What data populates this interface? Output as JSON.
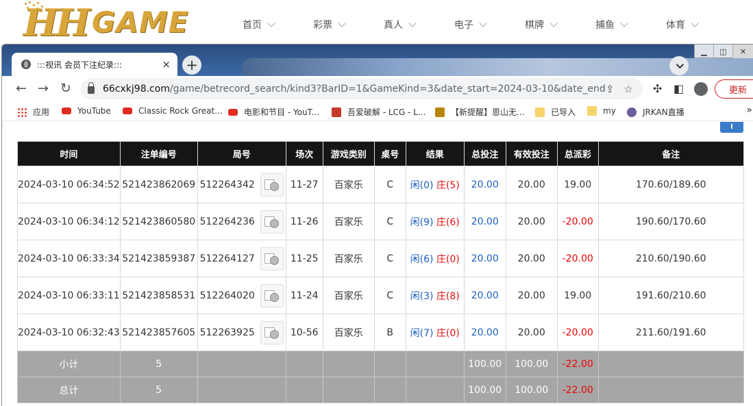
{
  "site": {
    "logo_hh": "HH",
    "logo_game": "GAME",
    "nav": [
      "首页",
      "彩票",
      "真人",
      "电子",
      "棋牌",
      "捕鱼",
      "体育"
    ]
  },
  "browser": {
    "tab_title": ":::视讯 会员下注纪录:::",
    "tab_close": "×",
    "new_tab": "+",
    "url_host": "66cxkj98.com",
    "url_path": "/game/betrecord_search/kind3?BarID=1&GameKind=3&date_start=2024-03-10&date_end...",
    "update_label": "更新",
    "bookmarks": [
      {
        "label": "应用",
        "icon": "apps-grid-icon"
      },
      {
        "label": "YouTube",
        "icon": "youtube-icon"
      },
      {
        "label": "Classic Rock Great...",
        "icon": "youtube-icon"
      },
      {
        "label": "电影和节目 - YouT...",
        "icon": "youtube-icon"
      },
      {
        "label": "吾爱破解 - LCG - L...",
        "icon": "site-icon"
      },
      {
        "label": "【新提醒】恩山无...",
        "icon": "site-icon"
      },
      {
        "label": "已导入",
        "icon": "folder-icon"
      },
      {
        "label": "my",
        "icon": "folder-icon"
      },
      {
        "label": "JRKAN直播",
        "icon": "site-icon"
      }
    ],
    "bookmarks_more": "»"
  },
  "table": {
    "headers": [
      "时间",
      "注单编号",
      "局号",
      "场次",
      "游戏类别",
      "桌号",
      "结果",
      "总投注",
      "有效投注",
      "总派彩",
      "备注"
    ],
    "rows": [
      {
        "time": "2024-03-10 06:34:52",
        "id": "521423862069",
        "ju": "512264342",
        "round": "11-27",
        "game": "百家乐",
        "table": "C",
        "xian": "闲(0)",
        "zhuang": "庄(5)",
        "bet": "20.00",
        "valid": "20.00",
        "payout": "19.00",
        "payout_neg": false,
        "note": "170.60/189.60"
      },
      {
        "time": "2024-03-10 06:34:12",
        "id": "521423860580",
        "ju": "512264236",
        "round": "11-26",
        "game": "百家乐",
        "table": "C",
        "xian": "闲(9)",
        "zhuang": "庄(6)",
        "bet": "20.00",
        "valid": "20.00",
        "payout": "-20.00",
        "payout_neg": true,
        "note": "190.60/170.60"
      },
      {
        "time": "2024-03-10 06:33:34",
        "id": "521423859387",
        "ju": "512264127",
        "round": "11-25",
        "game": "百家乐",
        "table": "C",
        "xian": "闲(6)",
        "zhuang": "庄(0)",
        "bet": "20.00",
        "valid": "20.00",
        "payout": "-20.00",
        "payout_neg": true,
        "note": "210.60/190.60"
      },
      {
        "time": "2024-03-10 06:33:11",
        "id": "521423858531",
        "ju": "512264020",
        "round": "11-24",
        "game": "百家乐",
        "table": "C",
        "xian": "闲(3)",
        "zhuang": "庄(8)",
        "bet": "20.00",
        "valid": "20.00",
        "payout": "19.00",
        "payout_neg": false,
        "note": "191.60/210.60"
      },
      {
        "time": "2024-03-10 06:32:43",
        "id": "521423857605",
        "ju": "512263925",
        "round": "10-56",
        "game": "百家乐",
        "table": "B",
        "xian": "闲(7)",
        "zhuang": "庄(0)",
        "bet": "20.00",
        "valid": "20.00",
        "payout": "-20.00",
        "payout_neg": true,
        "note": "211.60/191.60"
      }
    ],
    "subtotal": {
      "label": "小计",
      "count": "5",
      "bet": "100.00",
      "valid": "100.00",
      "payout": "-22.00"
    },
    "total": {
      "label": "总计",
      "count": "5",
      "bet": "100.00",
      "valid": "100.00",
      "payout": "-22.00"
    }
  },
  "colors": {
    "header_bg": "#151515",
    "total_bg": "#a6a6a6",
    "negative": "#ee0000",
    "link_blue": "#1b5fc2",
    "logo_gold": "#d8a53a"
  }
}
